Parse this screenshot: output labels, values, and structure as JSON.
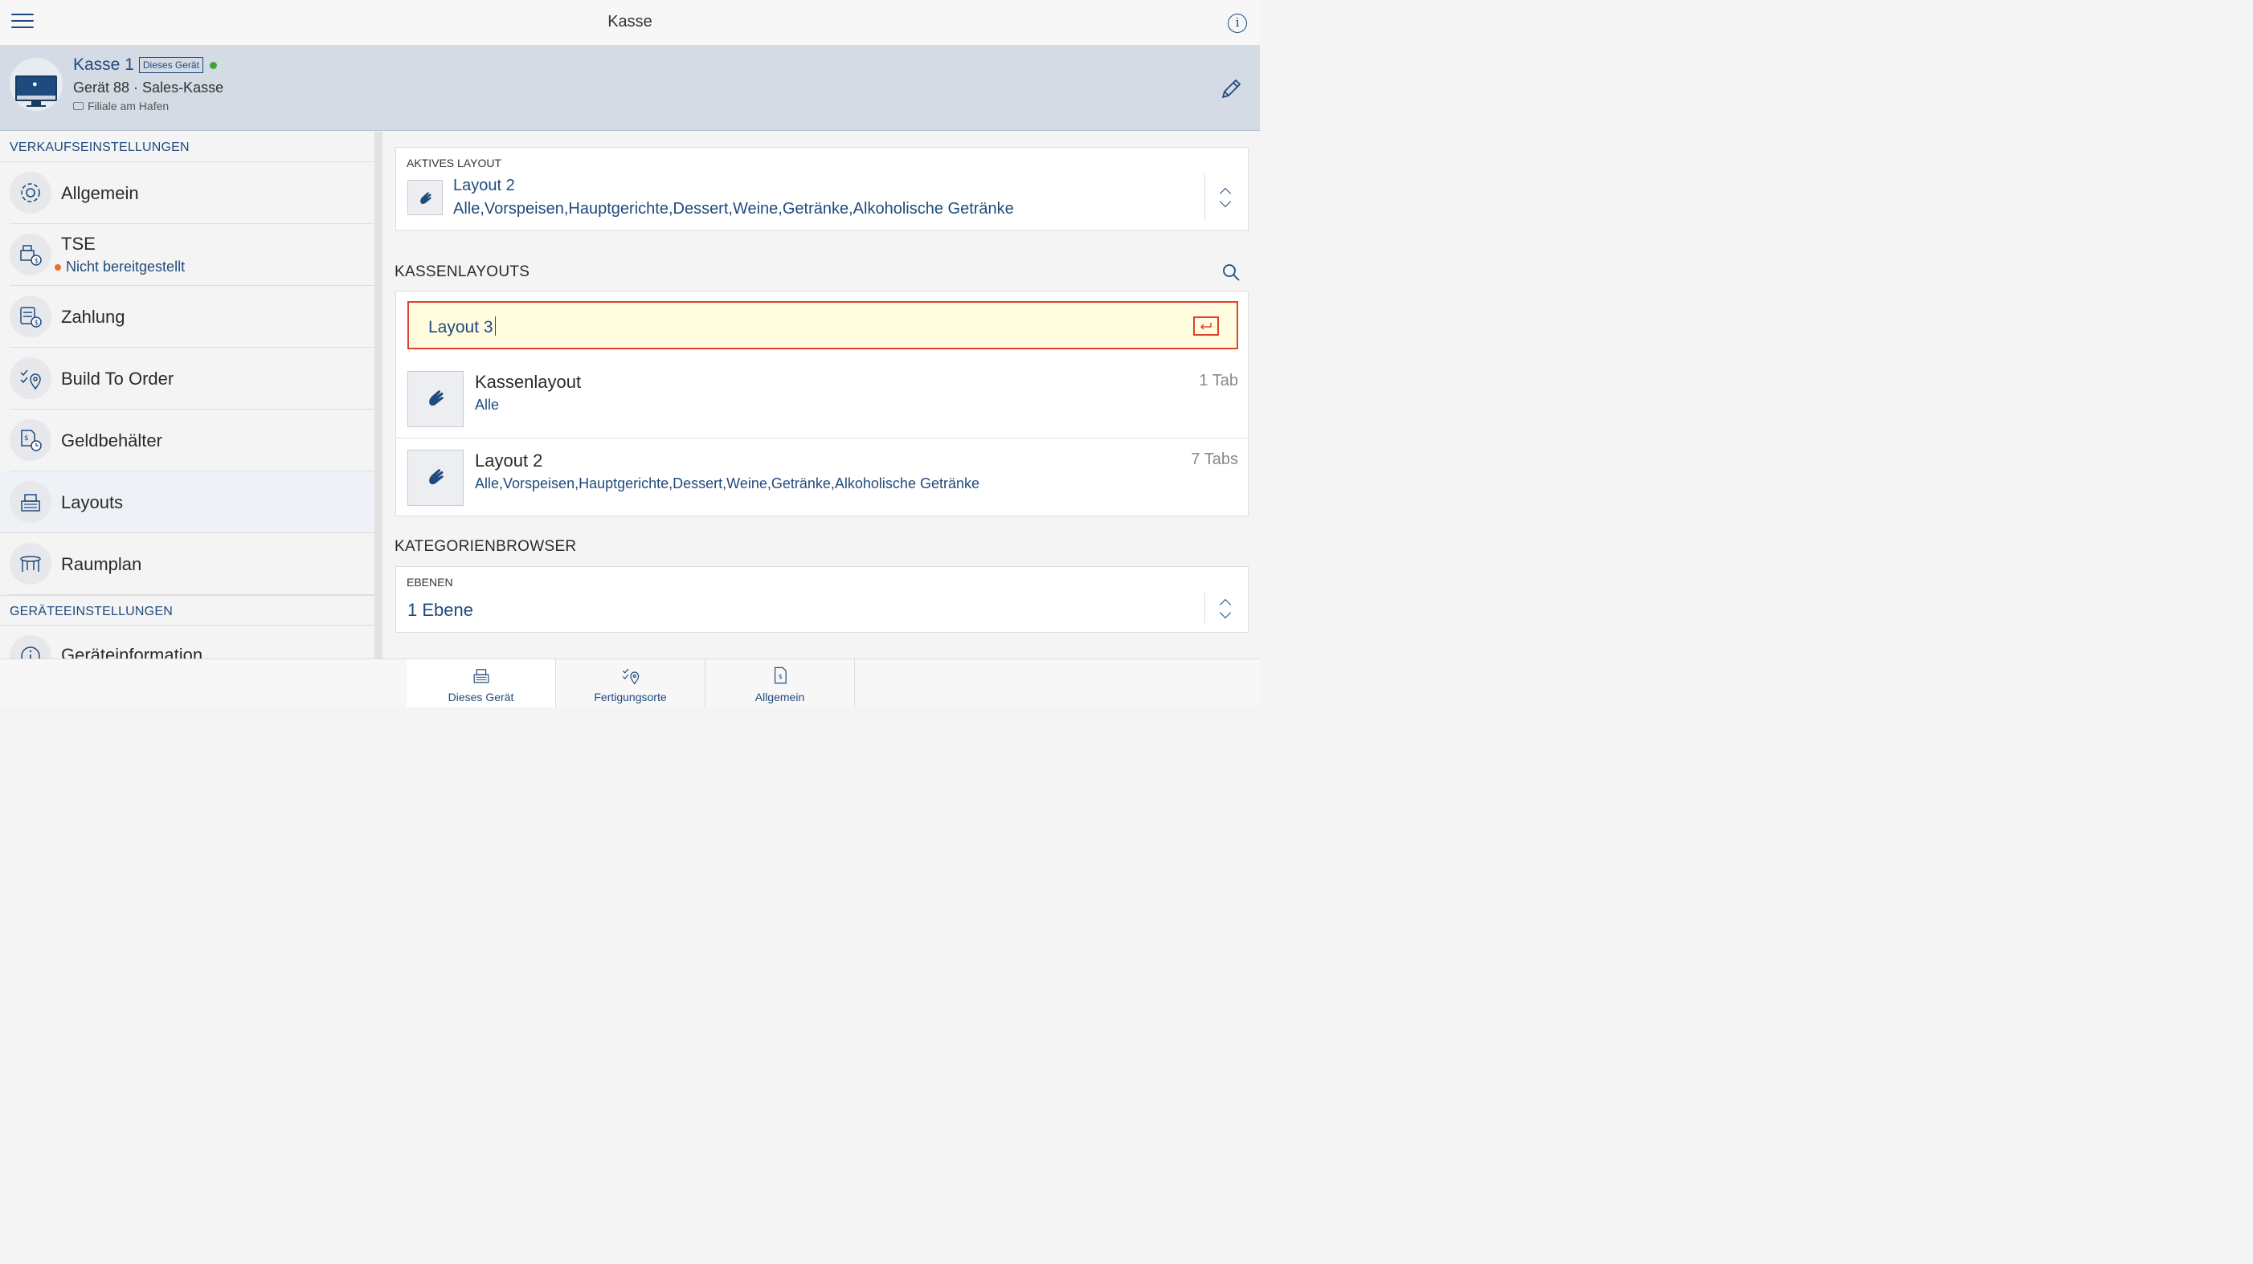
{
  "topbar": {
    "title": "Kasse"
  },
  "device": {
    "name": "Kasse 1",
    "badge": "Dieses Gerät",
    "status_color": "#3fa53a",
    "subtitle": "Gerät 88 · Sales-Kasse",
    "branch": "Filiale am Hafen"
  },
  "sidebar": {
    "section_sales": "VERKAUFSEINSTELLUNGEN",
    "items": [
      {
        "label": "Allgemein",
        "icon": "gear-icon"
      },
      {
        "label": "TSE",
        "status": "Nicht bereitgestellt",
        "icon": "tse-icon"
      },
      {
        "label": "Zahlung",
        "icon": "payment-icon"
      },
      {
        "label": "Build To Order",
        "icon": "build-to-order-icon"
      },
      {
        "label": "Geldbehälter",
        "icon": "cash-drawer-icon"
      },
      {
        "label": "Layouts",
        "icon": "cash-register-icon"
      },
      {
        "label": "Raumplan",
        "icon": "table-icon"
      }
    ],
    "section_device": "GERÄTEEINSTELLUNGEN",
    "device_items": [
      {
        "label": "Geräteinformation",
        "icon": "info-icon"
      }
    ]
  },
  "active_layout": {
    "label": "AKTIVES LAYOUT",
    "name": "Layout 2",
    "tabs": "Alle,Vorspeisen,Hauptgerichte,Dessert,Weine,Getränke,Alkoholische Getränke"
  },
  "layouts": {
    "heading": "KASSENLAYOUTS",
    "search_value": "Layout 3",
    "items": [
      {
        "name": "Kassenlayout",
        "tabs": "Alle",
        "count": "1 Tab"
      },
      {
        "name": "Layout 2",
        "tabs": "Alle,Vorspeisen,Hauptgerichte,Dessert,Weine,Getränke,Alkoholische Getränke",
        "count": "7 Tabs"
      }
    ]
  },
  "category_browser": {
    "heading": "KATEGORIENBROWSER",
    "label": "EBENEN",
    "value": "1 Ebene"
  },
  "bottom_tabs": [
    {
      "label": "Dieses Gerät",
      "active": true
    },
    {
      "label": "Fertigungsorte",
      "active": false
    },
    {
      "label": "Allgemein",
      "active": false
    }
  ],
  "colors": {
    "accent": "#1f4a7d",
    "highlight_border": "#e0412b",
    "search_bg": "#fffce0",
    "warning_dot": "#e8712c"
  }
}
